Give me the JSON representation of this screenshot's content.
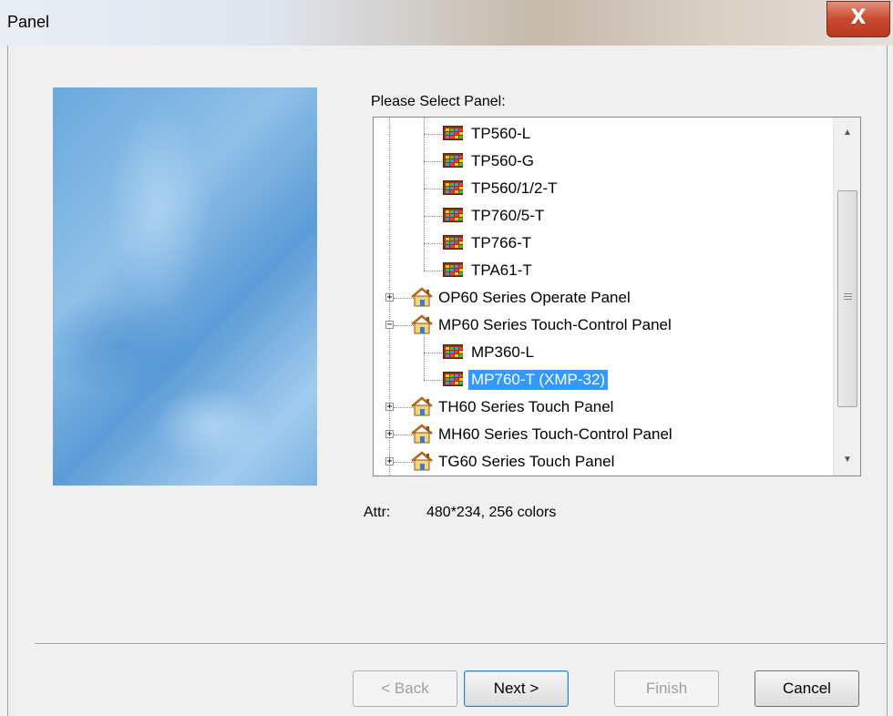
{
  "window": {
    "title": "Panel",
    "close_glyph": "X"
  },
  "prompt": "Please Select Panel:",
  "tree": {
    "items": [
      {
        "label": "TP560-L",
        "kind": "model",
        "level": 2
      },
      {
        "label": "TP560-G",
        "kind": "model",
        "level": 2
      },
      {
        "label": "TP560/1/2-T",
        "kind": "model",
        "level": 2
      },
      {
        "label": "TP760/5-T",
        "kind": "model",
        "level": 2
      },
      {
        "label": "TP766-T",
        "kind": "model",
        "level": 2
      },
      {
        "label": "TPA61-T",
        "kind": "model",
        "level": 2
      },
      {
        "label": "OP60 Series Operate Panel",
        "kind": "series",
        "level": 1,
        "expander": "+"
      },
      {
        "label": "MP60 Series Touch-Control Panel",
        "kind": "series",
        "level": 1,
        "expander": "−"
      },
      {
        "label": "MP360-L",
        "kind": "model",
        "level": 2
      },
      {
        "label": "MP760-T (XMP-32)",
        "kind": "model",
        "level": 2,
        "selected": true
      },
      {
        "label": "TH60 Series Touch Panel",
        "kind": "series",
        "level": 1,
        "expander": "+"
      },
      {
        "label": "MH60 Series Touch-Control Panel",
        "kind": "series",
        "level": 1,
        "expander": "+"
      },
      {
        "label": "TG60 Series Touch Panel",
        "kind": "series",
        "level": 1,
        "expander": "+"
      }
    ],
    "icons": {
      "model": "panel-grid-icon",
      "series": "house-folder-icon"
    }
  },
  "attr": {
    "label": "Attr:",
    "value": "480*234, 256 colors"
  },
  "buttons": {
    "back": "< Back",
    "next": "Next >",
    "finish": "Finish",
    "cancel": "Cancel"
  },
  "colors": {
    "selection": "#3399ff",
    "close_button": "#c74a30"
  }
}
